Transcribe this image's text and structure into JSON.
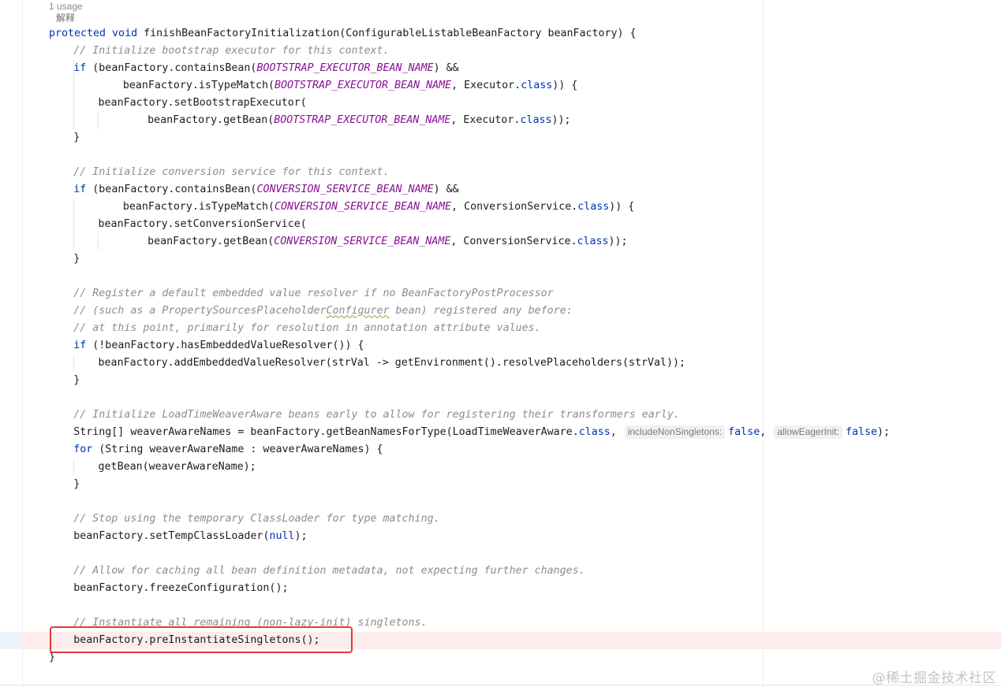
{
  "editor": {
    "usage_hint": "1 usage",
    "explain_label": "解释",
    "watermark": "@稀土掘金技术社区",
    "highlight_color": "#e53935",
    "lines": [
      {
        "indent": 0,
        "tokens": [
          {
            "t": "kw",
            "v": "protected void "
          },
          {
            "t": "txt",
            "v": "finishBeanFactoryInitialization(ConfigurableListableBeanFactory beanFactory) {"
          }
        ]
      },
      {
        "indent": 4,
        "tokens": [
          {
            "t": "cmt",
            "v": "// Initialize bootstrap executor for this context."
          }
        ]
      },
      {
        "indent": 4,
        "tokens": [
          {
            "t": "kw",
            "v": "if "
          },
          {
            "t": "txt",
            "v": "(beanFactory.containsBean("
          },
          {
            "t": "const",
            "v": "BOOTSTRAP_EXECUTOR_BEAN_NAME"
          },
          {
            "t": "txt",
            "v": ") &&"
          }
        ]
      },
      {
        "indent": 12,
        "tokens": [
          {
            "t": "txt",
            "v": "beanFactory.isTypeMatch("
          },
          {
            "t": "const",
            "v": "BOOTSTRAP_EXECUTOR_BEAN_NAME"
          },
          {
            "t": "txt",
            "v": ", Executor."
          },
          {
            "t": "kw",
            "v": "class"
          },
          {
            "t": "txt",
            "v": ")) {"
          }
        ]
      },
      {
        "indent": 8,
        "tokens": [
          {
            "t": "txt",
            "v": "beanFactory.setBootstrapExecutor("
          }
        ]
      },
      {
        "indent": 16,
        "tokens": [
          {
            "t": "txt",
            "v": "beanFactory.getBean("
          },
          {
            "t": "const",
            "v": "BOOTSTRAP_EXECUTOR_BEAN_NAME"
          },
          {
            "t": "txt",
            "v": ", Executor."
          },
          {
            "t": "kw",
            "v": "class"
          },
          {
            "t": "txt",
            "v": "));"
          }
        ]
      },
      {
        "indent": 4,
        "tokens": [
          {
            "t": "txt",
            "v": "}"
          }
        ]
      },
      {
        "indent": 0,
        "tokens": []
      },
      {
        "indent": 4,
        "tokens": [
          {
            "t": "cmt",
            "v": "// Initialize conversion service for this context."
          }
        ]
      },
      {
        "indent": 4,
        "tokens": [
          {
            "t": "kw",
            "v": "if "
          },
          {
            "t": "txt",
            "v": "(beanFactory.containsBean("
          },
          {
            "t": "const",
            "v": "CONVERSION_SERVICE_BEAN_NAME"
          },
          {
            "t": "txt",
            "v": ") &&"
          }
        ]
      },
      {
        "indent": 12,
        "tokens": [
          {
            "t": "txt",
            "v": "beanFactory.isTypeMatch("
          },
          {
            "t": "const",
            "v": "CONVERSION_SERVICE_BEAN_NAME"
          },
          {
            "t": "txt",
            "v": ", ConversionService."
          },
          {
            "t": "kw",
            "v": "class"
          },
          {
            "t": "txt",
            "v": ")) {"
          }
        ]
      },
      {
        "indent": 8,
        "tokens": [
          {
            "t": "txt",
            "v": "beanFactory.setConversionService("
          }
        ]
      },
      {
        "indent": 16,
        "tokens": [
          {
            "t": "txt",
            "v": "beanFactory.getBean("
          },
          {
            "t": "const",
            "v": "CONVERSION_SERVICE_BEAN_NAME"
          },
          {
            "t": "txt",
            "v": ", ConversionService."
          },
          {
            "t": "kw",
            "v": "class"
          },
          {
            "t": "txt",
            "v": "));"
          }
        ]
      },
      {
        "indent": 4,
        "tokens": [
          {
            "t": "txt",
            "v": "}"
          }
        ]
      },
      {
        "indent": 0,
        "tokens": []
      },
      {
        "indent": 4,
        "tokens": [
          {
            "t": "cmt",
            "v": "// Register a default embedded value resolver if no BeanFactoryPostProcessor"
          }
        ]
      },
      {
        "indent": 4,
        "tokens": [
          {
            "t": "cmt",
            "v": "// (such as a PropertySourcesPlaceholder"
          },
          {
            "t": "cmtsq",
            "v": "Configurer"
          },
          {
            "t": "cmt",
            "v": " bean) registered any before:"
          }
        ]
      },
      {
        "indent": 4,
        "tokens": [
          {
            "t": "cmt",
            "v": "// at this point, primarily for resolution in annotation attribute values."
          }
        ]
      },
      {
        "indent": 4,
        "tokens": [
          {
            "t": "kw",
            "v": "if "
          },
          {
            "t": "txt",
            "v": "(!beanFactory.hasEmbeddedValueResolver()) {"
          }
        ]
      },
      {
        "indent": 8,
        "tokens": [
          {
            "t": "txt",
            "v": "beanFactory.addEmbeddedValueResolver(strVal -> getEnvironment().resolvePlaceholders(strVal));"
          }
        ]
      },
      {
        "indent": 4,
        "tokens": [
          {
            "t": "txt",
            "v": "}"
          }
        ]
      },
      {
        "indent": 0,
        "tokens": []
      },
      {
        "indent": 4,
        "tokens": [
          {
            "t": "cmt",
            "v": "// Initialize LoadTimeWeaverAware beans early to allow for registering their transformers early."
          }
        ]
      },
      {
        "indent": 4,
        "tokens": [
          {
            "t": "txt",
            "v": "String[] weaverAwareNames = beanFactory.getBeanNamesForType(LoadTimeWeaverAware."
          },
          {
            "t": "kw",
            "v": "class"
          },
          {
            "t": "txt",
            "v": ", "
          },
          {
            "t": "hint",
            "v": "includeNonSingletons:"
          },
          {
            "t": "kw",
            "v": "false"
          },
          {
            "t": "txt",
            "v": ", "
          },
          {
            "t": "hint",
            "v": "allowEagerInit:"
          },
          {
            "t": "kw",
            "v": "false"
          },
          {
            "t": "txt",
            "v": ");"
          }
        ]
      },
      {
        "indent": 4,
        "tokens": [
          {
            "t": "kw",
            "v": "for "
          },
          {
            "t": "txt",
            "v": "(String weaverAwareName : weaverAwareNames) {"
          }
        ]
      },
      {
        "indent": 8,
        "tokens": [
          {
            "t": "txt",
            "v": "getBean(weaverAwareName);"
          }
        ]
      },
      {
        "indent": 4,
        "tokens": [
          {
            "t": "txt",
            "v": "}"
          }
        ]
      },
      {
        "indent": 0,
        "tokens": []
      },
      {
        "indent": 4,
        "tokens": [
          {
            "t": "cmt",
            "v": "// Stop using the temporary ClassLoader for type matching."
          }
        ]
      },
      {
        "indent": 4,
        "tokens": [
          {
            "t": "txt",
            "v": "beanFactory.setTempClassLoader("
          },
          {
            "t": "kw",
            "v": "null"
          },
          {
            "t": "txt",
            "v": ");"
          }
        ]
      },
      {
        "indent": 0,
        "tokens": []
      },
      {
        "indent": 4,
        "tokens": [
          {
            "t": "cmt",
            "v": "// Allow for caching all bean definition metadata, not expecting further changes."
          }
        ]
      },
      {
        "indent": 4,
        "tokens": [
          {
            "t": "txt",
            "v": "beanFactory.freezeConfiguration();"
          }
        ]
      },
      {
        "indent": 0,
        "tokens": []
      },
      {
        "indent": 4,
        "tokens": [
          {
            "t": "cmt",
            "v": "// Instantiate all remaining (non-lazy-init) singletons."
          }
        ]
      },
      {
        "indent": 4,
        "tokens": [
          {
            "t": "txt",
            "v": "beanFactory.preInstantiateSingletons();"
          }
        ]
      },
      {
        "indent": 0,
        "tokens": [
          {
            "t": "txt",
            "v": "}"
          }
        ]
      }
    ]
  }
}
